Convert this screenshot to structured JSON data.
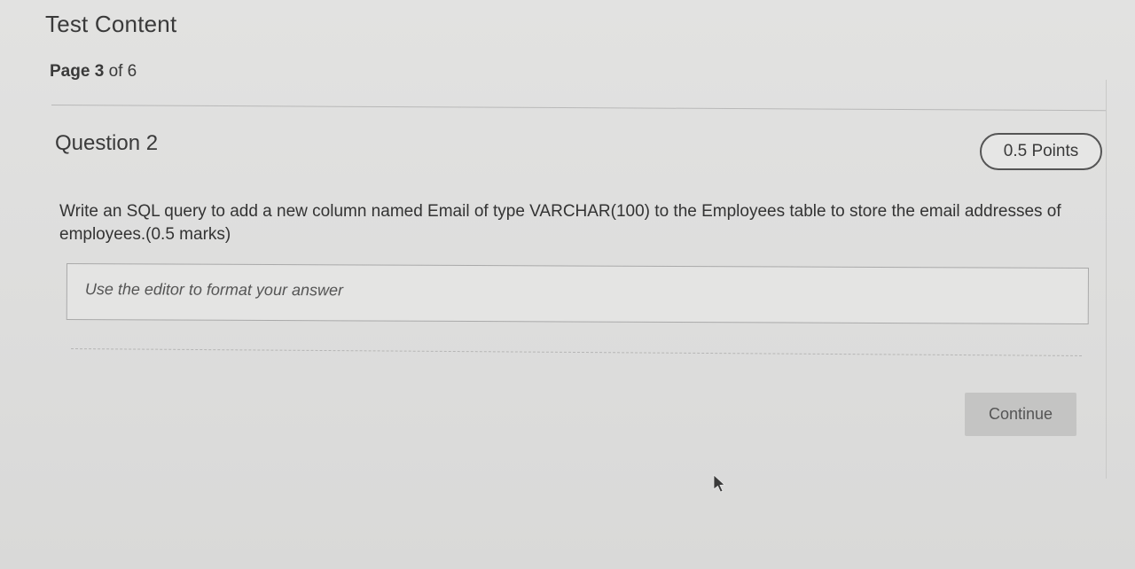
{
  "header": {
    "title": "Test Content",
    "page_label": "Page",
    "page_current": "3",
    "page_of": "of 6"
  },
  "question": {
    "heading": "Question 2",
    "points": "0.5 Points",
    "text": "Write an SQL query to add a new column named Email of type VARCHAR(100) to the Employees table to store the email addresses of employees.(0.5 marks)"
  },
  "answer": {
    "placeholder": "Use the editor to format your answer"
  },
  "actions": {
    "continue_label": "Continue"
  },
  "icons": {
    "cursor": "mouse-pointer-icon"
  },
  "colors": {
    "background": "#dededd",
    "text": "#333333",
    "button_bg": "#c4c4c3",
    "badge_border": "#555555"
  }
}
